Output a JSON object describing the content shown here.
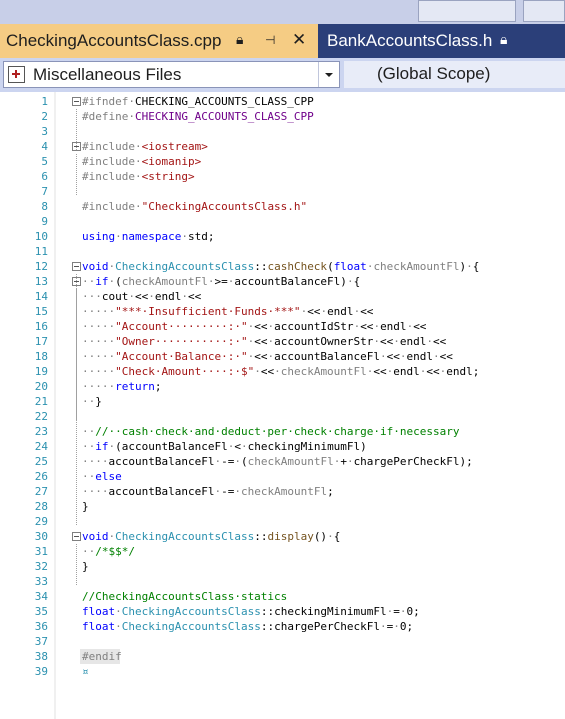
{
  "tabs": [
    {
      "label": "CheckingAccountsClass.cpp",
      "active": true,
      "icons": [
        "lock-icon",
        "pin-icon",
        "close-icon"
      ]
    },
    {
      "label": "BankAccountsClass.h",
      "active": false,
      "icons": [
        "lock-icon"
      ]
    }
  ],
  "nav": {
    "project": "Miscellaneous Files",
    "scope": "(Global Scope)"
  },
  "colors": {
    "tab_active_bg": "#f5cc84",
    "tabbar_bg": "#2b3f79",
    "keyword": "#0000ff",
    "type": "#2b91af",
    "string": "#a31515",
    "comment": "#008000",
    "preprocessor": "#808080",
    "macro": "#6f008a"
  },
  "code": [
    {
      "n": "1",
      "segs": [
        [
          "pp",
          "#ifndef"
        ],
        [
          "p",
          "·"
        ],
        [
          "d",
          "CHECKING_ACCOUNTS_CLASS_CPP"
        ]
      ]
    },
    {
      "n": "2",
      "segs": [
        [
          "pp",
          "#define"
        ],
        [
          "p",
          "·"
        ],
        [
          "m",
          "CHECKING_ACCOUNTS_CLASS_CPP"
        ]
      ]
    },
    {
      "n": "3",
      "segs": []
    },
    {
      "n": "4",
      "segs": [
        [
          "pp",
          "#include"
        ],
        [
          "p",
          "·"
        ],
        [
          "s",
          "<iostream>"
        ]
      ]
    },
    {
      "n": "5",
      "segs": [
        [
          "pp",
          "#include"
        ],
        [
          "p",
          "·"
        ],
        [
          "s",
          "<iomanip>"
        ]
      ]
    },
    {
      "n": "6",
      "segs": [
        [
          "pp",
          "#include"
        ],
        [
          "p",
          "·"
        ],
        [
          "s",
          "<string>"
        ]
      ]
    },
    {
      "n": "7",
      "segs": []
    },
    {
      "n": "8",
      "segs": [
        [
          "pp",
          "#include"
        ],
        [
          "p",
          "·"
        ],
        [
          "s",
          "\"CheckingAccountsClass.h\""
        ]
      ]
    },
    {
      "n": "9",
      "segs": []
    },
    {
      "n": "10",
      "segs": [
        [
          "k",
          "using"
        ],
        [
          "p",
          "·"
        ],
        [
          "k",
          "namespace"
        ],
        [
          "p",
          "·"
        ],
        [
          "d",
          "std;"
        ]
      ]
    },
    {
      "n": "11",
      "segs": []
    },
    {
      "n": "12",
      "segs": [
        [
          "k",
          "void"
        ],
        [
          "p",
          "·"
        ],
        [
          "t",
          "CheckingAccountsClass"
        ],
        [
          "d",
          "::"
        ],
        [
          "fn",
          "cashCheck"
        ],
        [
          "d",
          "("
        ],
        [
          "k",
          "float"
        ],
        [
          "p",
          "·"
        ],
        [
          "p",
          "checkAmountFl"
        ],
        [
          "d",
          ")"
        ],
        [
          "p",
          "·"
        ],
        [
          "d",
          "{"
        ]
      ]
    },
    {
      "n": "13",
      "segs": [
        [
          "p",
          "··"
        ],
        [
          "k",
          "if"
        ],
        [
          "p",
          "·"
        ],
        [
          "d",
          "("
        ],
        [
          "p",
          "checkAmountFl"
        ],
        [
          "p",
          "·"
        ],
        [
          "d",
          ">="
        ],
        [
          "p",
          "·"
        ],
        [
          "d",
          "accountBalanceFl)"
        ],
        [
          "p",
          "·"
        ],
        [
          "d",
          "{"
        ]
      ]
    },
    {
      "n": "14",
      "segs": [
        [
          "p",
          "···"
        ],
        [
          "d",
          "cout"
        ],
        [
          "p",
          "·"
        ],
        [
          "d",
          "<<"
        ],
        [
          "p",
          "·"
        ],
        [
          "d",
          "endl"
        ],
        [
          "p",
          "·"
        ],
        [
          "d",
          "<<"
        ]
      ]
    },
    {
      "n": "15",
      "segs": [
        [
          "p",
          "·····"
        ],
        [
          "s",
          "\"***·Insufficient·Funds·***\""
        ],
        [
          "p",
          "·"
        ],
        [
          "d",
          "<<"
        ],
        [
          "p",
          "·"
        ],
        [
          "d",
          "endl"
        ],
        [
          "p",
          "·"
        ],
        [
          "d",
          "<<"
        ]
      ]
    },
    {
      "n": "16",
      "segs": [
        [
          "p",
          "·····"
        ],
        [
          "s",
          "\"Account·········:·\""
        ],
        [
          "p",
          "·"
        ],
        [
          "d",
          "<<"
        ],
        [
          "p",
          "·"
        ],
        [
          "d",
          "accountIdStr"
        ],
        [
          "p",
          "·"
        ],
        [
          "d",
          "<<"
        ],
        [
          "p",
          "·"
        ],
        [
          "d",
          "endl"
        ],
        [
          "p",
          "·"
        ],
        [
          "d",
          "<<"
        ]
      ]
    },
    {
      "n": "17",
      "segs": [
        [
          "p",
          "·····"
        ],
        [
          "s",
          "\"Owner···········:·\""
        ],
        [
          "p",
          "·"
        ],
        [
          "d",
          "<<"
        ],
        [
          "p",
          "·"
        ],
        [
          "d",
          "accountOwnerStr"
        ],
        [
          "p",
          "·"
        ],
        [
          "d",
          "<<"
        ],
        [
          "p",
          "·"
        ],
        [
          "d",
          "endl"
        ],
        [
          "p",
          "·"
        ],
        [
          "d",
          "<<"
        ]
      ]
    },
    {
      "n": "18",
      "segs": [
        [
          "p",
          "·····"
        ],
        [
          "s",
          "\"Account·Balance·:·\""
        ],
        [
          "p",
          "·"
        ],
        [
          "d",
          "<<"
        ],
        [
          "p",
          "·"
        ],
        [
          "d",
          "accountBalanceFl"
        ],
        [
          "p",
          "·"
        ],
        [
          "d",
          "<<"
        ],
        [
          "p",
          "·"
        ],
        [
          "d",
          "endl"
        ],
        [
          "p",
          "·"
        ],
        [
          "d",
          "<<"
        ]
      ]
    },
    {
      "n": "19",
      "segs": [
        [
          "p",
          "·····"
        ],
        [
          "s",
          "\"Check·Amount····:·$\""
        ],
        [
          "p",
          "·"
        ],
        [
          "d",
          "<<"
        ],
        [
          "p",
          "·"
        ],
        [
          "p",
          "checkAmountFl"
        ],
        [
          "p",
          "·"
        ],
        [
          "d",
          "<<"
        ],
        [
          "p",
          "·"
        ],
        [
          "d",
          "endl"
        ],
        [
          "p",
          "·"
        ],
        [
          "d",
          "<<"
        ],
        [
          "p",
          "·"
        ],
        [
          "d",
          "endl;"
        ]
      ]
    },
    {
      "n": "20",
      "segs": [
        [
          "p",
          "·····"
        ],
        [
          "k",
          "return"
        ],
        [
          "d",
          ";"
        ]
      ]
    },
    {
      "n": "21",
      "segs": [
        [
          "p",
          "··"
        ],
        [
          "d",
          "}"
        ]
      ]
    },
    {
      "n": "22",
      "segs": []
    },
    {
      "n": "23",
      "segs": [
        [
          "p",
          "··"
        ],
        [
          "c",
          "//··cash·check·and·deduct·per·check·charge·if·necessary"
        ]
      ]
    },
    {
      "n": "24",
      "segs": [
        [
          "p",
          "··"
        ],
        [
          "k",
          "if"
        ],
        [
          "p",
          "·"
        ],
        [
          "d",
          "(accountBalanceFl"
        ],
        [
          "p",
          "·"
        ],
        [
          "d",
          "<"
        ],
        [
          "p",
          "·"
        ],
        [
          "d",
          "checkingMinimumFl)"
        ]
      ]
    },
    {
      "n": "25",
      "segs": [
        [
          "p",
          "····"
        ],
        [
          "d",
          "accountBalanceFl"
        ],
        [
          "p",
          "·"
        ],
        [
          "d",
          "-="
        ],
        [
          "p",
          "·"
        ],
        [
          "d",
          "("
        ],
        [
          "p",
          "checkAmountFl"
        ],
        [
          "p",
          "·"
        ],
        [
          "d",
          "+"
        ],
        [
          "p",
          "·"
        ],
        [
          "d",
          "chargePerCheckFl);"
        ]
      ]
    },
    {
      "n": "26",
      "segs": [
        [
          "p",
          "··"
        ],
        [
          "k",
          "else"
        ]
      ]
    },
    {
      "n": "27",
      "segs": [
        [
          "p",
          "····"
        ],
        [
          "d",
          "accountBalanceFl"
        ],
        [
          "p",
          "·"
        ],
        [
          "d",
          "-="
        ],
        [
          "p",
          "·"
        ],
        [
          "p",
          "checkAmountFl"
        ],
        [
          "d",
          ";"
        ]
      ]
    },
    {
      "n": "28",
      "segs": [
        [
          "d",
          "}"
        ]
      ]
    },
    {
      "n": "29",
      "segs": []
    },
    {
      "n": "30",
      "segs": [
        [
          "k",
          "void"
        ],
        [
          "p",
          "·"
        ],
        [
          "t",
          "CheckingAccountsClass"
        ],
        [
          "d",
          "::"
        ],
        [
          "fn",
          "display"
        ],
        [
          "d",
          "()"
        ],
        [
          "p",
          "·"
        ],
        [
          "d",
          "{"
        ]
      ]
    },
    {
      "n": "31",
      "segs": [
        [
          "p",
          "··"
        ],
        [
          "c",
          "/*$$*/"
        ]
      ]
    },
    {
      "n": "32",
      "segs": [
        [
          "d",
          "}"
        ]
      ]
    },
    {
      "n": "33",
      "segs": []
    },
    {
      "n": "34",
      "segs": [
        [
          "c",
          "//CheckingAccountsClass·statics"
        ]
      ]
    },
    {
      "n": "35",
      "segs": [
        [
          "k",
          "float"
        ],
        [
          "p",
          "·"
        ],
        [
          "t",
          "CheckingAccountsClass"
        ],
        [
          "d",
          "::checkingMinimumFl"
        ],
        [
          "p",
          "·"
        ],
        [
          "d",
          "="
        ],
        [
          "p",
          "·"
        ],
        [
          "d",
          "0;"
        ]
      ]
    },
    {
      "n": "36",
      "segs": [
        [
          "k",
          "float"
        ],
        [
          "p",
          "·"
        ],
        [
          "t",
          "CheckingAccountsClass"
        ],
        [
          "d",
          "::chargePerCheckFl"
        ],
        [
          "p",
          "·"
        ],
        [
          "d",
          "="
        ],
        [
          "p",
          "·"
        ],
        [
          "d",
          "0;"
        ]
      ]
    },
    {
      "n": "37",
      "segs": []
    },
    {
      "n": "38",
      "segs": [
        [
          "pp",
          "#endif"
        ]
      ]
    },
    {
      "n": "39",
      "segs": [
        [
          "t",
          "¤"
        ]
      ]
    }
  ]
}
